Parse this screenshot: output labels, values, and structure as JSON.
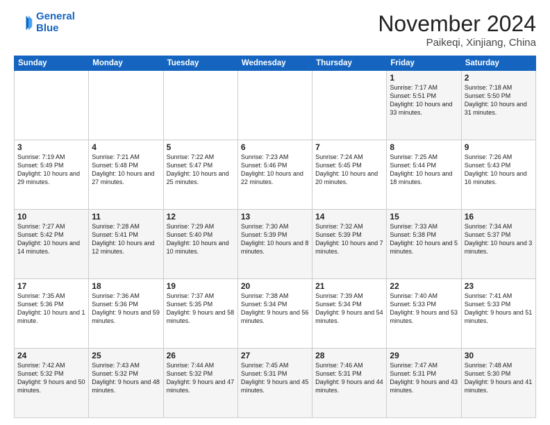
{
  "header": {
    "logo_line1": "General",
    "logo_line2": "Blue",
    "month_title": "November 2024",
    "location": "Paikeqi, Xinjiang, China"
  },
  "days_of_week": [
    "Sunday",
    "Monday",
    "Tuesday",
    "Wednesday",
    "Thursday",
    "Friday",
    "Saturday"
  ],
  "weeks": [
    [
      {
        "day": "",
        "text": ""
      },
      {
        "day": "",
        "text": ""
      },
      {
        "day": "",
        "text": ""
      },
      {
        "day": "",
        "text": ""
      },
      {
        "day": "",
        "text": ""
      },
      {
        "day": "1",
        "text": "Sunrise: 7:17 AM\nSunset: 5:51 PM\nDaylight: 10 hours and 33 minutes."
      },
      {
        "day": "2",
        "text": "Sunrise: 7:18 AM\nSunset: 5:50 PM\nDaylight: 10 hours and 31 minutes."
      }
    ],
    [
      {
        "day": "3",
        "text": "Sunrise: 7:19 AM\nSunset: 5:49 PM\nDaylight: 10 hours and 29 minutes."
      },
      {
        "day": "4",
        "text": "Sunrise: 7:21 AM\nSunset: 5:48 PM\nDaylight: 10 hours and 27 minutes."
      },
      {
        "day": "5",
        "text": "Sunrise: 7:22 AM\nSunset: 5:47 PM\nDaylight: 10 hours and 25 minutes."
      },
      {
        "day": "6",
        "text": "Sunrise: 7:23 AM\nSunset: 5:46 PM\nDaylight: 10 hours and 22 minutes."
      },
      {
        "day": "7",
        "text": "Sunrise: 7:24 AM\nSunset: 5:45 PM\nDaylight: 10 hours and 20 minutes."
      },
      {
        "day": "8",
        "text": "Sunrise: 7:25 AM\nSunset: 5:44 PM\nDaylight: 10 hours and 18 minutes."
      },
      {
        "day": "9",
        "text": "Sunrise: 7:26 AM\nSunset: 5:43 PM\nDaylight: 10 hours and 16 minutes."
      }
    ],
    [
      {
        "day": "10",
        "text": "Sunrise: 7:27 AM\nSunset: 5:42 PM\nDaylight: 10 hours and 14 minutes."
      },
      {
        "day": "11",
        "text": "Sunrise: 7:28 AM\nSunset: 5:41 PM\nDaylight: 10 hours and 12 minutes."
      },
      {
        "day": "12",
        "text": "Sunrise: 7:29 AM\nSunset: 5:40 PM\nDaylight: 10 hours and 10 minutes."
      },
      {
        "day": "13",
        "text": "Sunrise: 7:30 AM\nSunset: 5:39 PM\nDaylight: 10 hours and 8 minutes."
      },
      {
        "day": "14",
        "text": "Sunrise: 7:32 AM\nSunset: 5:39 PM\nDaylight: 10 hours and 7 minutes."
      },
      {
        "day": "15",
        "text": "Sunrise: 7:33 AM\nSunset: 5:38 PM\nDaylight: 10 hours and 5 minutes."
      },
      {
        "day": "16",
        "text": "Sunrise: 7:34 AM\nSunset: 5:37 PM\nDaylight: 10 hours and 3 minutes."
      }
    ],
    [
      {
        "day": "17",
        "text": "Sunrise: 7:35 AM\nSunset: 5:36 PM\nDaylight: 10 hours and 1 minute."
      },
      {
        "day": "18",
        "text": "Sunrise: 7:36 AM\nSunset: 5:36 PM\nDaylight: 9 hours and 59 minutes."
      },
      {
        "day": "19",
        "text": "Sunrise: 7:37 AM\nSunset: 5:35 PM\nDaylight: 9 hours and 58 minutes."
      },
      {
        "day": "20",
        "text": "Sunrise: 7:38 AM\nSunset: 5:34 PM\nDaylight: 9 hours and 56 minutes."
      },
      {
        "day": "21",
        "text": "Sunrise: 7:39 AM\nSunset: 5:34 PM\nDaylight: 9 hours and 54 minutes."
      },
      {
        "day": "22",
        "text": "Sunrise: 7:40 AM\nSunset: 5:33 PM\nDaylight: 9 hours and 53 minutes."
      },
      {
        "day": "23",
        "text": "Sunrise: 7:41 AM\nSunset: 5:33 PM\nDaylight: 9 hours and 51 minutes."
      }
    ],
    [
      {
        "day": "24",
        "text": "Sunrise: 7:42 AM\nSunset: 5:32 PM\nDaylight: 9 hours and 50 minutes."
      },
      {
        "day": "25",
        "text": "Sunrise: 7:43 AM\nSunset: 5:32 PM\nDaylight: 9 hours and 48 minutes."
      },
      {
        "day": "26",
        "text": "Sunrise: 7:44 AM\nSunset: 5:32 PM\nDaylight: 9 hours and 47 minutes."
      },
      {
        "day": "27",
        "text": "Sunrise: 7:45 AM\nSunset: 5:31 PM\nDaylight: 9 hours and 45 minutes."
      },
      {
        "day": "28",
        "text": "Sunrise: 7:46 AM\nSunset: 5:31 PM\nDaylight: 9 hours and 44 minutes."
      },
      {
        "day": "29",
        "text": "Sunrise: 7:47 AM\nSunset: 5:31 PM\nDaylight: 9 hours and 43 minutes."
      },
      {
        "day": "30",
        "text": "Sunrise: 7:48 AM\nSunset: 5:30 PM\nDaylight: 9 hours and 41 minutes."
      }
    ]
  ]
}
